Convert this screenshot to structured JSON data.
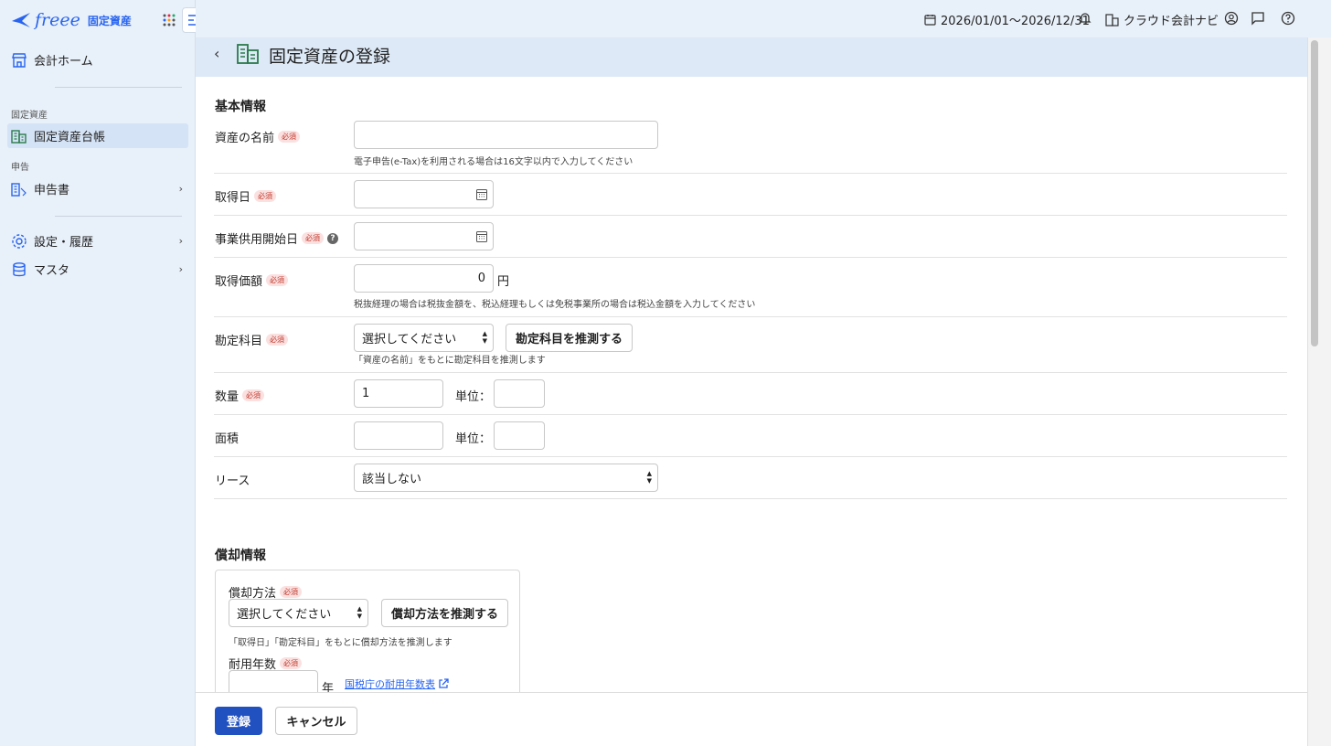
{
  "app": {
    "brand": "freee",
    "product": "固定資産"
  },
  "sidebar": {
    "home": "会計ホーム",
    "section_assets": "固定資産",
    "ledger": "固定資産台帳",
    "section_filing": "申告",
    "filing": "申告書",
    "settings": "設定・履歴",
    "master": "マスタ"
  },
  "topbar": {
    "period": "2026/01/01〜2026/12/31",
    "navi": "クラウド会計ナビ"
  },
  "page": {
    "title": "固定資産の登録"
  },
  "basic": {
    "title": "基本情報",
    "required": "必須",
    "asset_name_label": "資産の名前",
    "asset_name_value": "",
    "asset_name_hint": "電子申告(e-Tax)を利用される場合は16文字以内で入力してください",
    "acquire_date_label": "取得日",
    "acquire_date_value": "",
    "business_start_label": "事業供用開始日",
    "business_start_value": "",
    "price_label": "取得価額",
    "price_value": "0",
    "price_unit": "円",
    "price_hint": "税抜経理の場合は税抜金額を、税込経理もしくは免税事業所の場合は税込金額を入力してください",
    "account_label": "勘定科目",
    "account_value": "選択してください",
    "account_guess_button": "勘定科目を推測する",
    "account_hint": "「資産の名前」をもとに勘定科目を推測します",
    "quantity_label": "数量",
    "quantity_value": "1",
    "unit_label": "単位：",
    "area_label": "面積",
    "lease_label": "リース",
    "lease_value": "該当しない"
  },
  "depreciation": {
    "title": "償却情報",
    "method_label": "償却方法",
    "method_value": "選択してください",
    "method_guess_button": "償却方法を推測する",
    "method_hint": "「取得日」「勘定科目」をもとに償却方法を推測します",
    "years_label": "耐用年数",
    "years_unit": "年",
    "years_link": "国税庁の耐用年数表"
  },
  "footer": {
    "submit": "登録",
    "cancel": "キャンセル"
  },
  "colors": {
    "primary": "#2150c0",
    "brand": "#2864f0",
    "sidebar_bg": "#e8f0f9",
    "required_bg": "#fbe0e0"
  }
}
